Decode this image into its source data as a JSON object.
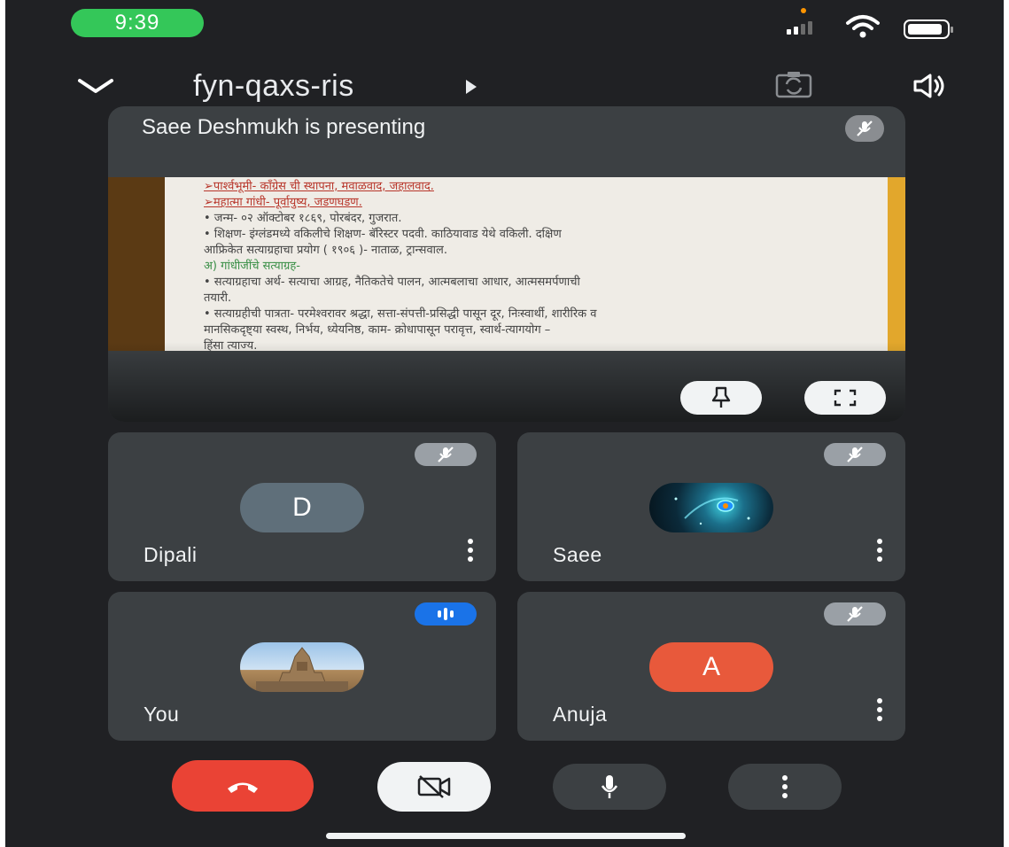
{
  "status_bar": {
    "time": "9:39"
  },
  "header": {
    "meeting_code": "fyn-qaxs-ris"
  },
  "presentation": {
    "label": "Saee Deshmukh is presenting",
    "slide_lines": [
      "➢पार्श्वभूमी- काँग्रेस ची स्थापना, मवाळवाद, जहालवाद.",
      "➢महात्मा गांधी- पूर्वायुष्य, जडणघडण.",
      "• जन्म- ०२ ऑक्टोबर १८६९, पोरबंदर, गुजरात.",
      "• शिक्षण- इंग्लंडमध्ये वकिलीचे शिक्षण- बॅरिस्टर पदवी. काठियावाड येथे वकिली. दक्षिण",
      "   आफ्रिकेत सत्याग्रहाचा प्रयोग ( १९०६ )- नाताळ, ट्रान्सवाल.",
      "अ) गांधीजींचे सत्याग्रह-",
      "• सत्याग्रहाचा अर्थ- सत्याचा आग्रह, नैतिकतेचे पालन, आत्मबलाचा आधार, आत्मसमर्पणाची",
      "   तयारी.",
      "• सत्याग्रहीची पात्रता- परमेश्वरावर श्रद्धा, सत्ता-संपत्ती-प्रसिद्धी पासून दूर, निःस्वार्थी, शारीरिक व",
      "   मानसिकदृष्ट्या स्वस्थ, निर्भय, ध्येयनिष्ठ, काम- क्रोधापासून परावृत्त, स्वार्थ-त्यागयोग –",
      "   हिंसा त्याज्य."
    ]
  },
  "participants": [
    {
      "name": "Dipali",
      "initial": "D",
      "avatar_color": "#5f6f7a",
      "muted": true
    },
    {
      "name": "Saee",
      "initial": "",
      "avatar_color": "#0b2a3a",
      "muted": true
    },
    {
      "name": "You",
      "initial": "",
      "avatar_color": "#8fb3d9",
      "speaking": true
    },
    {
      "name": "Anuja",
      "initial": "A",
      "avatar_color": "#e8593b",
      "muted": true
    }
  ],
  "colors": {
    "background": "#202124",
    "tile": "#3c4043",
    "end_call": "#ea4335",
    "speaking": "#1a73e8",
    "status_pill": "#34c759"
  },
  "icons": {
    "back": "chevron-down-icon",
    "flip_camera": "camera-flip-icon",
    "audio": "speaker-icon",
    "pin": "pin-icon",
    "fullscreen": "fullscreen-icon",
    "muted": "mic-off-icon",
    "end_call": "phone-hangup-icon",
    "camera": "camera-off-icon",
    "mic": "mic-icon",
    "more": "more-vert-icon"
  }
}
